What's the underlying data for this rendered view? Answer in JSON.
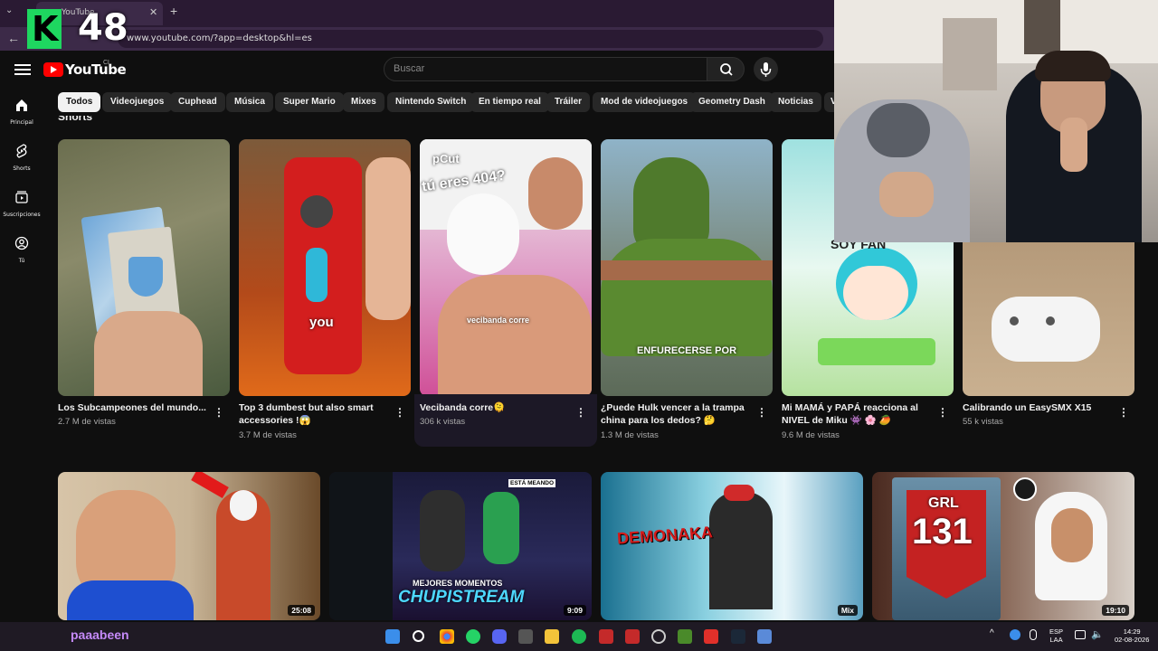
{
  "browser": {
    "tab_title": "YouTube",
    "tab_close": "✕",
    "new_tab": "+",
    "url": "www.youtube.com/?app=desktop&hl=es"
  },
  "overlay": {
    "kick_logo": "K",
    "viewer_count": "48",
    "streamer_name": "paaabeen"
  },
  "header": {
    "logo_text": "YouTube",
    "country_code": "CL",
    "search_placeholder": "Buscar"
  },
  "sidebar": {
    "items": [
      {
        "label": "Principal",
        "icon": "home-icon"
      },
      {
        "label": "Shorts",
        "icon": "shorts-icon"
      },
      {
        "label": "Suscripciones",
        "icon": "subscriptions-icon"
      },
      {
        "label": "Tú",
        "icon": "you-icon"
      }
    ]
  },
  "chips": [
    "Todos",
    "Videojuegos",
    "Cuphead",
    "Música",
    "Super Mario",
    "Mixes",
    "Nintendo Switch",
    "En tiempo real",
    "Tráiler",
    "Mod de videojuegos",
    "Geometry Dash",
    "Noticias",
    "V"
  ],
  "shorts": {
    "heading": "Shorts",
    "items": [
      {
        "title": "Los Subcampeones del mundo...",
        "views": "2.7 M de vistas",
        "overlay": ""
      },
      {
        "title": "Top 3 dumbest but also smart accessories !😱",
        "views": "3.7 M de vistas",
        "overlay": "you"
      },
      {
        "title": "Vecibanda corre🫠",
        "views": "306 k vistas",
        "overlay": "vecibanda corre",
        "overlay2": "tú eres 404?",
        "overlay3": "pCut"
      },
      {
        "title": "¿Puede Hulk vencer a la trampa china para los dedos? 🤔",
        "views": "1.3 M de vistas",
        "overlay": "ENFURECERSE POR"
      },
      {
        "title": "Mi MAMÁ y PAPÁ reacciona al NIVEL de Miku 👾 🌸 🥭",
        "views": "9.6 M de vistas",
        "overlay": "SOY FAN"
      },
      {
        "title": "Calibrando un EasySMX X15",
        "views": "55 k vistas",
        "overlay": ""
      }
    ]
  },
  "videos": [
    {
      "duration": "25:08",
      "overlay": ""
    },
    {
      "duration": "9:09",
      "overlay": "MEJORES MOMENTOS",
      "overlay2": "CHUPISTREAM",
      "overlay3": "ESTÁ MEANDO"
    },
    {
      "duration": "Mix",
      "overlay": "DEMONAKA"
    },
    {
      "duration": "19:10",
      "overlay": "GRL",
      "overlay2": "131"
    }
  ],
  "taskbar": {
    "lang_top": "ESP",
    "lang_bottom": "LAA",
    "time": "14:29",
    "date": "02-08-2026"
  },
  "colors": {
    "background": "#0f0f0f",
    "accent": "#ff0000",
    "kick_green": "#1ed760",
    "chip_bg": "#272727",
    "streamer_name": "#c58af9"
  }
}
